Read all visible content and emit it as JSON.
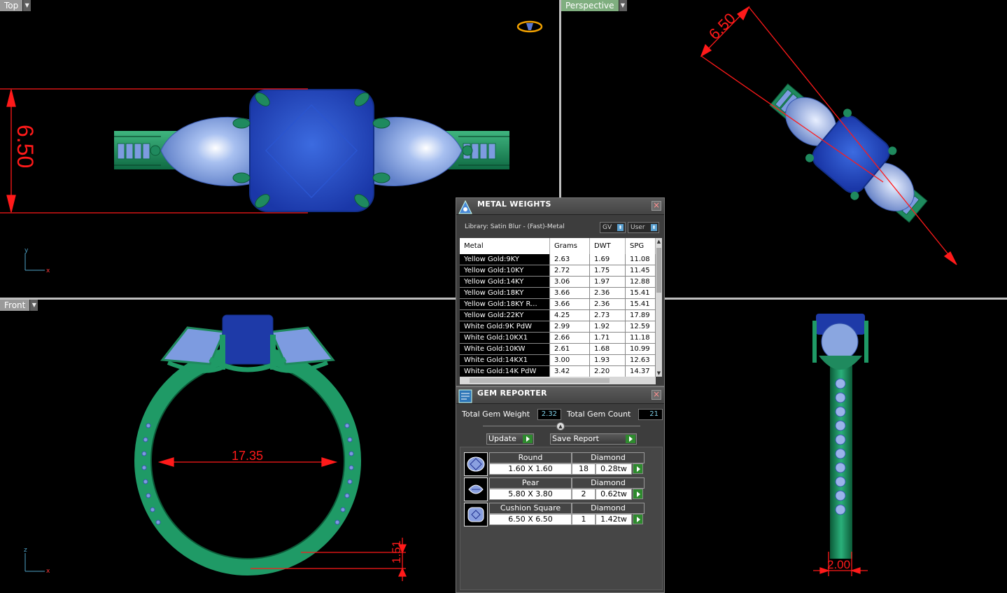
{
  "viewports": {
    "top": {
      "label": "Top",
      "dimension": "6.50",
      "axis_y": "y",
      "axis_x": "x"
    },
    "perspective": {
      "label": "Perspective",
      "dimension": "6.50"
    },
    "front": {
      "label": "Front",
      "inner_diameter": "17.35",
      "shank_thickness": "1.51",
      "axis_z": "z",
      "axis_x": "x"
    },
    "right": {
      "width": "2.00"
    }
  },
  "metal_weights": {
    "title": "METAL WEIGHTS",
    "library": "Library: Satin Blur - (Fast)-Metal",
    "gv_select": "GV",
    "user_select": "User",
    "columns": [
      "Metal",
      "Grams",
      "DWT",
      "SPG"
    ],
    "rows": [
      [
        "Yellow Gold:9KY",
        "2.63",
        "1.69",
        "11.08"
      ],
      [
        "Yellow Gold:10KY",
        "2.72",
        "1.75",
        "11.45"
      ],
      [
        "Yellow Gold:14KY",
        "3.06",
        "1.97",
        "12.88"
      ],
      [
        "Yellow Gold:18KY",
        "3.66",
        "2.36",
        "15.41"
      ],
      [
        "Yellow Gold:18KY R...",
        "3.66",
        "2.36",
        "15.41"
      ],
      [
        "Yellow Gold:22KY",
        "4.25",
        "2.73",
        "17.89"
      ],
      [
        "White Gold:9K PdW",
        "2.99",
        "1.92",
        "12.59"
      ],
      [
        "White Gold:10KX1",
        "2.66",
        "1.71",
        "11.18"
      ],
      [
        "White Gold:10KW",
        "2.61",
        "1.68",
        "10.99"
      ],
      [
        "White Gold:14KX1",
        "3.00",
        "1.93",
        "12.63"
      ],
      [
        "White Gold:14K PdW",
        "3.42",
        "2.20",
        "14.37"
      ]
    ]
  },
  "gem_reporter": {
    "title": "GEM REPORTER",
    "total_weight_label": "Total Gem Weight",
    "total_weight": "2.32",
    "total_count_label": "Total Gem Count",
    "total_count": "21",
    "update_label": "Update",
    "save_label": "Save Report",
    "gems": [
      {
        "shape": "Round",
        "material": "Diamond",
        "size": "1.60 X 1.60",
        "count": "18",
        "weight": "0.28tw"
      },
      {
        "shape": "Pear",
        "material": "Diamond",
        "size": "5.80 X 3.80",
        "count": "2",
        "weight": "0.62tw"
      },
      {
        "shape": "Cushion Square",
        "material": "Diamond",
        "size": "6.50 X 6.50",
        "count": "1",
        "weight": "1.42tw"
      }
    ]
  },
  "colors": {
    "metal": "#1f8a5e",
    "center_stone": "#2a4fc0",
    "side_stone": "#7d9be0",
    "dimension": "#ff1a1a"
  }
}
